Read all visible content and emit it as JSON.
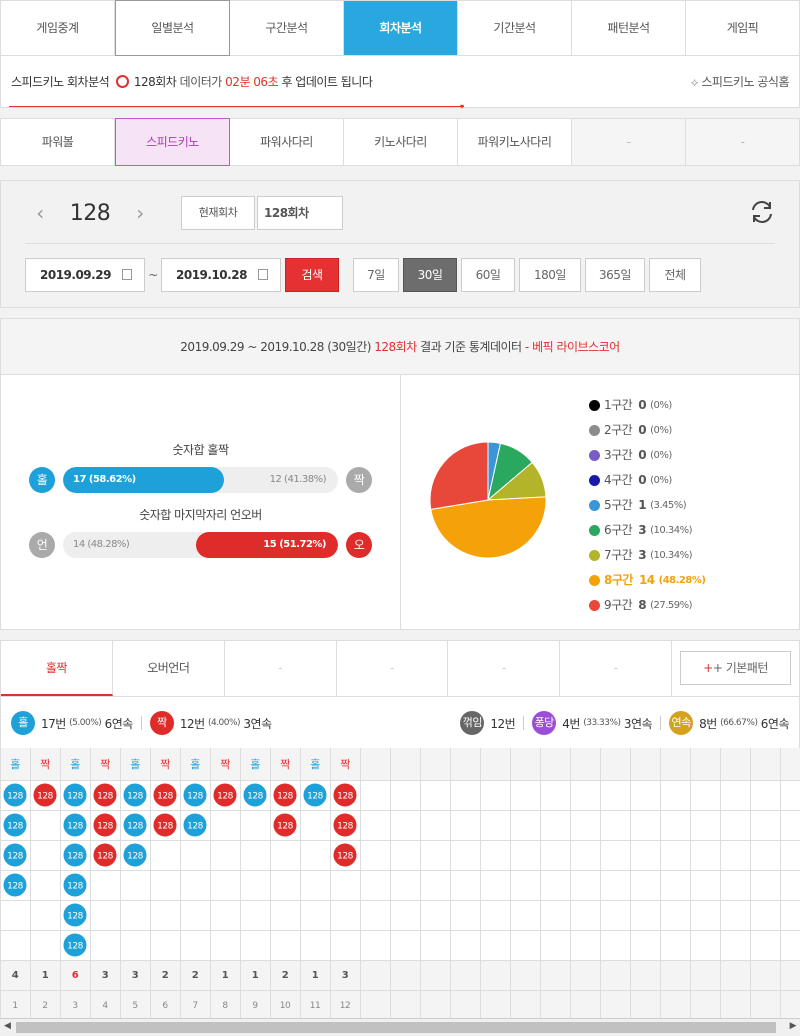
{
  "main_tabs": [
    "게임중계",
    "일별분석",
    "구간분석",
    "회차분석",
    "기간분석",
    "패턴분석",
    "게임픽"
  ],
  "info": {
    "prefix": "스피드키노 회차분석",
    "round": "128회차",
    "mid": "데이터가",
    "time": "02분 06초",
    "suffix": "후 업데이트 됩니다",
    "home": "스피드키노 공식홈"
  },
  "game_tabs": [
    "파워볼",
    "스피드키노",
    "파워사다리",
    "키노사다리",
    "파워키노사다리",
    "-",
    "-"
  ],
  "filter": {
    "round": "128",
    "current_btn": "현재회차",
    "round_value": "128회차",
    "date_from": "2019.09.29",
    "tilde": "~",
    "date_to": "2019.10.28",
    "search": "검색",
    "periods": [
      "7일",
      "30일",
      "60일",
      "180일",
      "365일",
      "전체"
    ]
  },
  "stats": {
    "head_range": "2019.09.29 ~ 2019.10.28 (30일간)",
    "head_round": "128회차",
    "head_mid": "결과 기준 통계데이터",
    "head_brand": "- 베픽 라이브스코어",
    "bar1": {
      "title": "숫자합 홀짝",
      "left_badge": "홀",
      "left_label": "17 (58.62%)",
      "left_pct": 58.62,
      "right_label": "12 (41.38%)",
      "right_badge": "짝"
    },
    "bar2": {
      "title": "숫자합 마지막자리 언오버",
      "left_badge": "언",
      "left_label": "14 (48.28%)",
      "right_pct": 51.72,
      "right_label": "15 (51.72%)",
      "right_badge": "오"
    }
  },
  "chart_data": {
    "type": "pie",
    "categories": [
      "1구간",
      "2구간",
      "3구간",
      "4구간",
      "5구간",
      "6구간",
      "7구간",
      "8구간",
      "9구간"
    ],
    "values": [
      0,
      0,
      0,
      0,
      1,
      3,
      3,
      14,
      8
    ],
    "labels": [
      "0 (0%)",
      "0 (0%)",
      "0 (0%)",
      "0 (0%)",
      "1 (3.45%)",
      "3 (10.34%)",
      "3 (10.34%)",
      "14 (48.28%)",
      "8 (27.59%)"
    ],
    "colors": [
      "#000000",
      "#8c8c8c",
      "#7a5cc7",
      "#1a1aa8",
      "#3b95d6",
      "#2ba860",
      "#b4b42a",
      "#f5a20a",
      "#e8483a"
    ],
    "highlight": 7
  },
  "pattern_tabs": [
    "홀짝",
    "오버언더",
    "-",
    "-",
    "-",
    "-",
    "-"
  ],
  "plus_btn": "+ 기본패턴",
  "summary": {
    "odd_badge": "홀",
    "odd_text": "17번",
    "odd_pct": "(5.00%)",
    "odd_streak": "6연속",
    "even_badge": "짝",
    "even_text": "12번",
    "even_pct": "(4.00%)",
    "even_streak": "3연속",
    "break_badge": "꺾임",
    "break_text": "12번",
    "bounce_badge": "퐁당",
    "bounce_text": "4번",
    "bounce_pct": "(33.33%)",
    "bounce_streak": "3연속",
    "cont_badge": "연속",
    "cont_text": "8번",
    "cont_pct": "(66.67%)",
    "cont_streak": "6연속"
  },
  "pattern": {
    "headers": [
      "홀",
      "짝",
      "홀",
      "짝",
      "홀",
      "짝",
      "홀",
      "짝",
      "홀",
      "짝",
      "홀",
      "짝"
    ],
    "counts": [
      4,
      1,
      6,
      3,
      3,
      2,
      2,
      1,
      1,
      2,
      1,
      3
    ],
    "max_index": 2,
    "index_labels": [
      "1",
      "2",
      "3",
      "4",
      "5",
      "6",
      "7",
      "8",
      "9",
      "10",
      "11",
      "12"
    ],
    "cell_label": "128",
    "odd_color": "#1ea0d8",
    "even_color": "#e02b2b"
  }
}
